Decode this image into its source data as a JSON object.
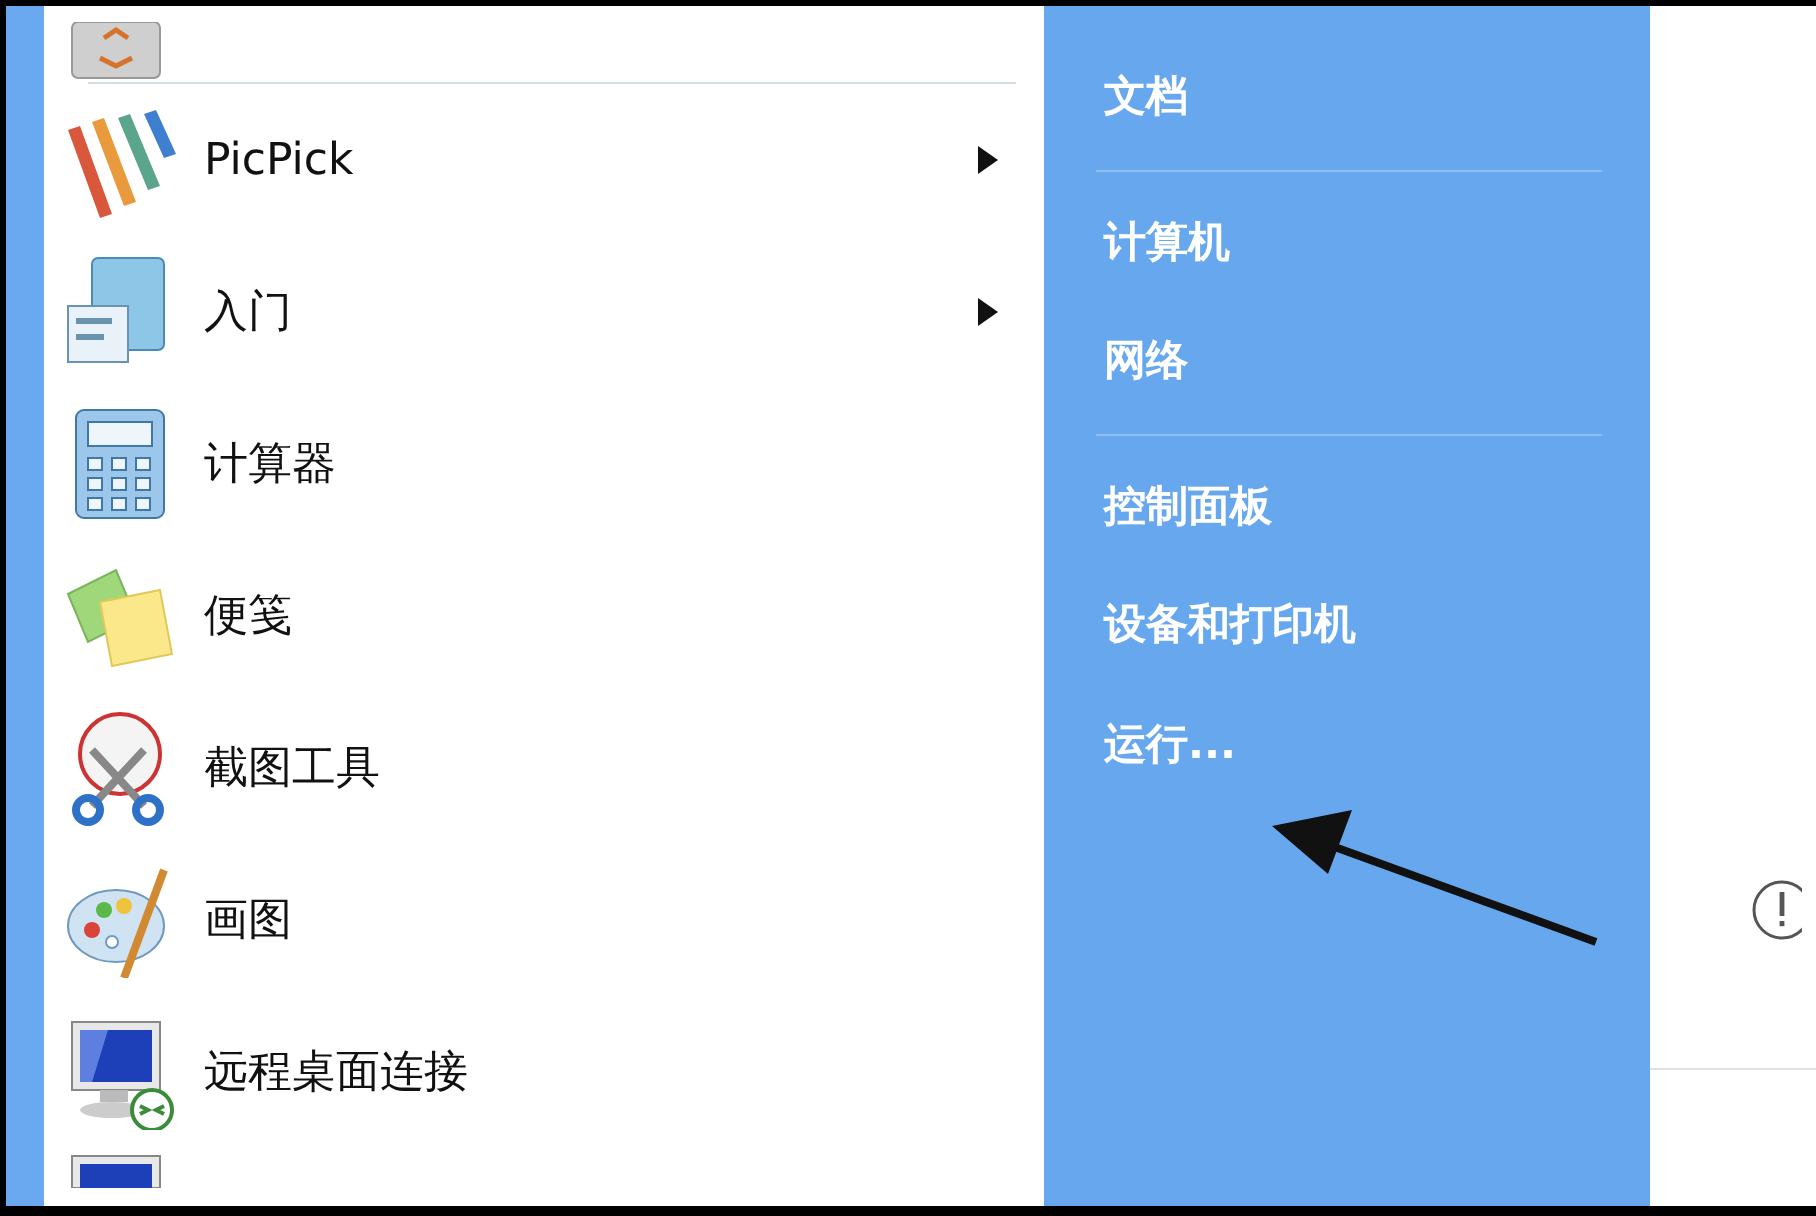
{
  "programs": [
    {
      "label": "PicPick",
      "kind": "picpick",
      "submenu": true
    },
    {
      "label": "入门",
      "kind": "getting-started",
      "submenu": true
    },
    {
      "label": "计算器",
      "kind": "calculator",
      "submenu": false
    },
    {
      "label": "便笺",
      "kind": "sticky-notes",
      "submenu": false
    },
    {
      "label": "截图工具",
      "kind": "snipping",
      "submenu": false
    },
    {
      "label": "画图",
      "kind": "paint",
      "submenu": false
    },
    {
      "label": "远程桌面连接",
      "kind": "remote",
      "submenu": false
    }
  ],
  "places": [
    {
      "kind": "link",
      "label": "文档"
    },
    {
      "kind": "divider"
    },
    {
      "kind": "link",
      "label": "计算机"
    },
    {
      "kind": "link",
      "label": "网络"
    },
    {
      "kind": "divider"
    },
    {
      "kind": "link",
      "label": "控制面板"
    },
    {
      "kind": "link",
      "label": "设备和打印机"
    },
    {
      "kind": "link",
      "label": "运行..."
    }
  ]
}
